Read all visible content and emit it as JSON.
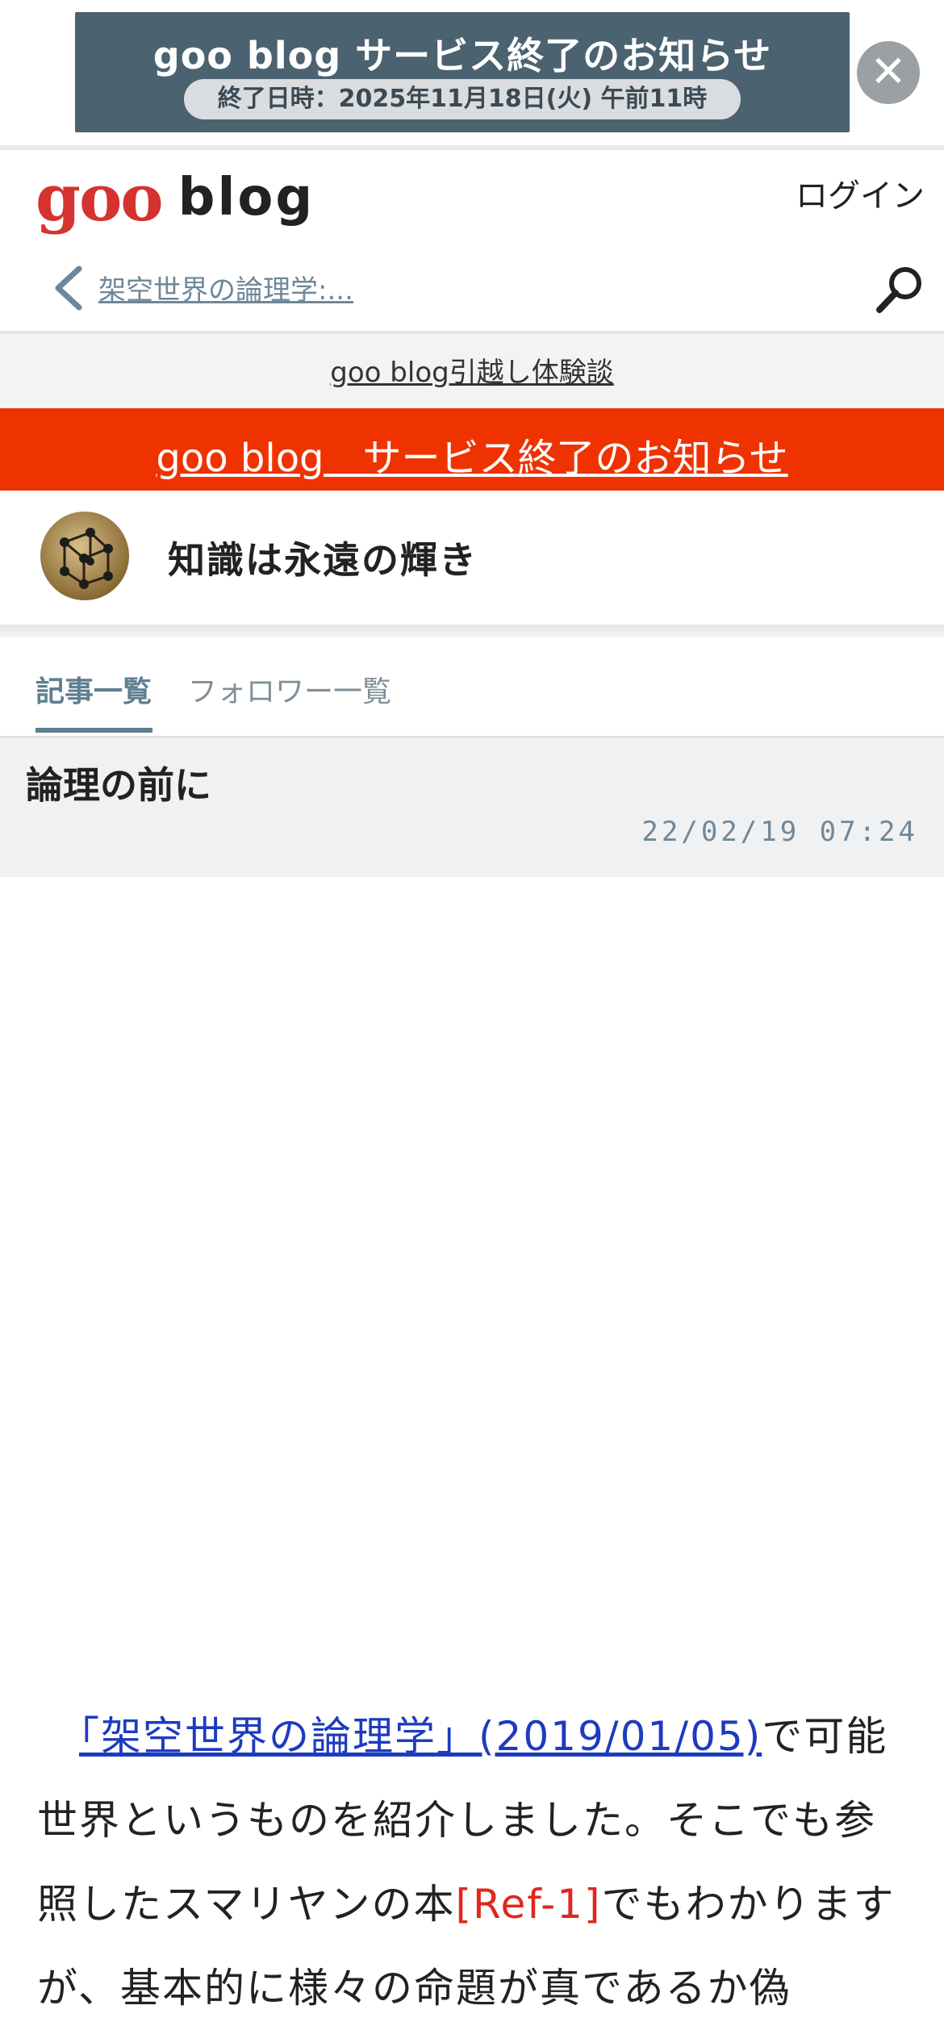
{
  "promo": {
    "title": "goo blog サービス終了のお知らせ",
    "subtitle": "終了日時：2025年11月18日(火) 午前11時",
    "close_icon": "close-icon"
  },
  "header": {
    "logo_goo": "goo",
    "logo_blog": "blog",
    "login_label": "ログイン"
  },
  "breadcrumb": {
    "label": "架空世界の論理学:..."
  },
  "notice_link": "goo blog引越し体験談",
  "service_end_link": "goo blog　サービス終了のお知らせ",
  "blog": {
    "title": "知識は永遠の輝き"
  },
  "tabs": [
    {
      "label": "記事一覧",
      "active": true
    },
    {
      "label": "フォロワー一覧",
      "active": false
    }
  ],
  "post": {
    "title": "論理の前に",
    "date": "22/02/19 07:24"
  },
  "article": {
    "link_text": "「架空世界の論理学」(2019/01/05)",
    "text_1": "で可能世界というものを紹介しました。そこでも参照したスマリヤンの本",
    "ref": "[Ref-1]",
    "text_2": "でもわかりますが、基本的に様々の命題が真であるか偽"
  },
  "colors": {
    "accent_red": "#ef3300",
    "logo_red": "#d5332f",
    "tab_active": "#5f7f91",
    "promo_bg": "#4b6270",
    "link_blue": "#1d3bbf"
  }
}
